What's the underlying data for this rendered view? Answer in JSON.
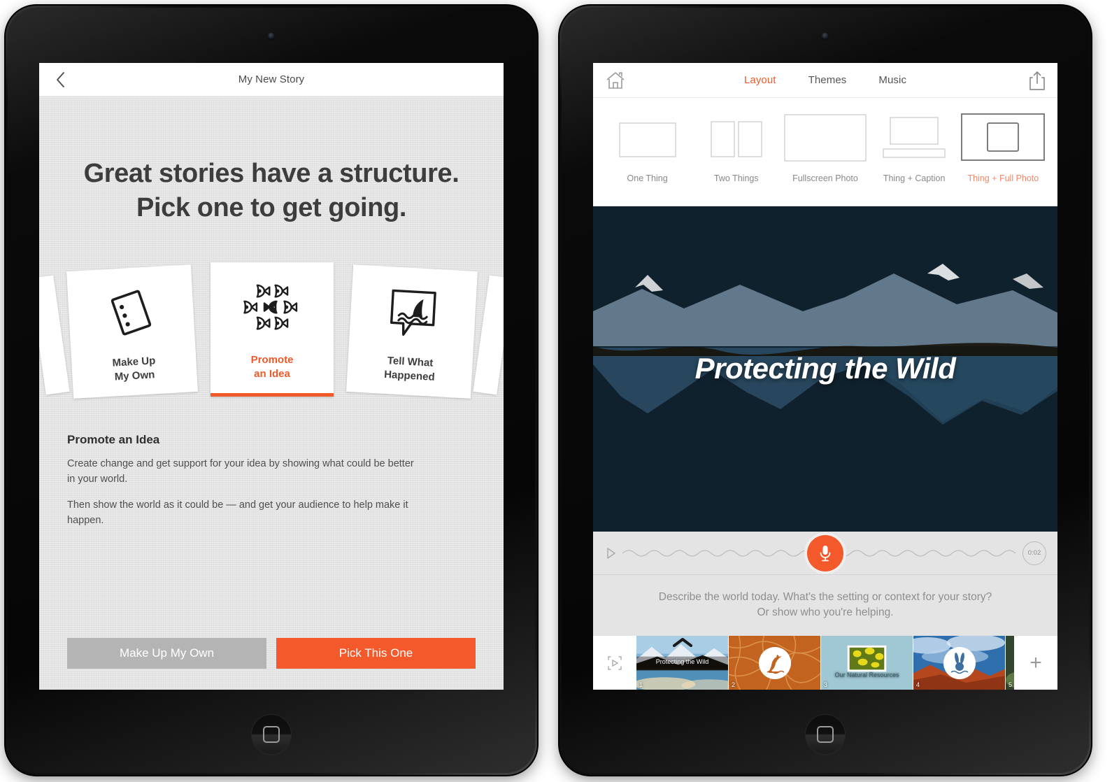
{
  "left_device": {
    "nav": {
      "back_icon": "chevron-left-icon",
      "title": "My New Story"
    },
    "headline_line1": "Great stories have a structure.",
    "headline_line2": "Pick one to get going.",
    "cards": [
      {
        "label_line1": "Make Up",
        "label_line2": "My Own",
        "icon": "tilted-card-list-icon",
        "selected": false
      },
      {
        "label_line1": "Promote",
        "label_line2": "an Idea",
        "icon": "school-of-fish-icon",
        "selected": true
      },
      {
        "label_line1": "Tell What",
        "label_line2": "Happened",
        "icon": "shark-fin-speech-bubble-icon",
        "selected": false
      }
    ],
    "description": {
      "heading": "Promote an Idea",
      "paragraph1": "Create change and get support for your idea by showing what could be better in your world.",
      "paragraph2": "Then show the world as it could be — and get your audience to help make it happen."
    },
    "buttons": {
      "secondary": "Make Up My Own",
      "primary": "Pick This One"
    },
    "colors": {
      "accent": "#f05a28",
      "primary_button": "#f4592c",
      "secondary_button": "#b4b4b4",
      "body_background": "#e3e3e3"
    }
  },
  "right_device": {
    "nav": {
      "home_icon": "home-icon",
      "share_icon": "share-upload-icon",
      "tabs": [
        {
          "label": "Layout",
          "active": true
        },
        {
          "label": "Themes",
          "active": false
        },
        {
          "label": "Music",
          "active": false
        }
      ]
    },
    "layouts": [
      {
        "name": "One Thing",
        "icon": "single-rect-icon",
        "active": false
      },
      {
        "name": "Two Things",
        "icon": "two-rects-icon",
        "active": false
      },
      {
        "name": "Fullscreen Photo",
        "icon": "large-rect-icon",
        "active": false
      },
      {
        "name": "Thing + Caption",
        "icon": "rect-with-caption-icon",
        "active": false
      },
      {
        "name": "Thing + Full Photo",
        "icon": "rect-inside-rect-icon",
        "active": true
      }
    ],
    "slide": {
      "title": "Protecting the Wild",
      "photo_alt": "snowy-mountain-lake-reflection-photo"
    },
    "audio": {
      "play_icon": "play-icon",
      "record_icon": "microphone-icon",
      "waveform_icon": "waveform-icon",
      "duration": "0:02"
    },
    "prompt_line1": "Describe the world today. What's the setting or context for your story?",
    "prompt_line2": "Or show who you're helping.",
    "filmstrip": {
      "preview_icon": "preview-play-icon",
      "add_icon": "+",
      "slides": [
        {
          "number": "1",
          "caption": "Protecting the Wild",
          "badge": "",
          "selected": true
        },
        {
          "number": "2",
          "caption": "",
          "badge": "heron-icon",
          "selected": false
        },
        {
          "number": "3",
          "caption": "Our Natural Resources",
          "badge": "",
          "selected": false
        },
        {
          "number": "4",
          "caption": "",
          "badge": "rabbit-icon",
          "selected": false
        },
        {
          "number": "5",
          "caption": "",
          "badge": "",
          "selected": false
        }
      ]
    },
    "colors": {
      "accent": "#f05a28",
      "record_button": "#f4592c",
      "panel_background": "#e4e4e4"
    }
  }
}
